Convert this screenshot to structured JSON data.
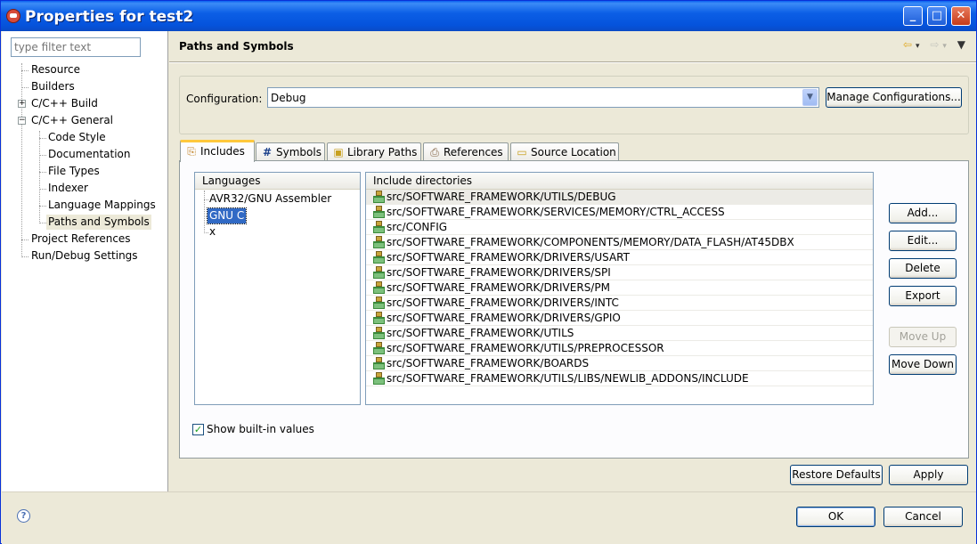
{
  "window": {
    "title": "Properties for test2"
  },
  "nav": {
    "filter_placeholder": "type filter text",
    "items": [
      {
        "label": "Resource"
      },
      {
        "label": "Builders"
      },
      {
        "label": "C/C++ Build"
      },
      {
        "label": "C/C++ General"
      },
      {
        "label": "Code Style"
      },
      {
        "label": "Documentation"
      },
      {
        "label": "File Types"
      },
      {
        "label": "Indexer"
      },
      {
        "label": "Language Mappings"
      },
      {
        "label": "Paths and Symbols"
      },
      {
        "label": "Project References"
      },
      {
        "label": "Run/Debug Settings"
      }
    ]
  },
  "page": {
    "title": "Paths and Symbols"
  },
  "config": {
    "label": "Configuration:",
    "value": "Debug",
    "manage_label": "Manage Configurations..."
  },
  "tabs": [
    {
      "label": "Includes",
      "icon": "includes-icon"
    },
    {
      "label": "Symbols",
      "icon": "hash-icon"
    },
    {
      "label": "Library Paths",
      "icon": "library-icon"
    },
    {
      "label": "References",
      "icon": "references-icon"
    },
    {
      "label": "Source Location",
      "icon": "folder-icon"
    }
  ],
  "languages": {
    "header": "Languages",
    "items": [
      "AVR32/GNU Assembler",
      "GNU C",
      "x"
    ],
    "selected": "GNU C"
  },
  "includes": {
    "header": "Include directories",
    "items": [
      "src/SOFTWARE_FRAMEWORK/UTILS/DEBUG",
      "src/SOFTWARE_FRAMEWORK/SERVICES/MEMORY/CTRL_ACCESS",
      "src/CONFIG",
      "src/SOFTWARE_FRAMEWORK/COMPONENTS/MEMORY/DATA_FLASH/AT45DBX",
      "src/SOFTWARE_FRAMEWORK/DRIVERS/USART",
      "src/SOFTWARE_FRAMEWORK/DRIVERS/SPI",
      "src/SOFTWARE_FRAMEWORK/DRIVERS/PM",
      "src/SOFTWARE_FRAMEWORK/DRIVERS/INTC",
      "src/SOFTWARE_FRAMEWORK/DRIVERS/GPIO",
      "src/SOFTWARE_FRAMEWORK/UTILS",
      "src/SOFTWARE_FRAMEWORK/UTILS/PREPROCESSOR",
      "src/SOFTWARE_FRAMEWORK/BOARDS",
      "src/SOFTWARE_FRAMEWORK/UTILS/LIBS/NEWLIB_ADDONS/INCLUDE"
    ]
  },
  "side_buttons": {
    "add": "Add...",
    "edit": "Edit...",
    "delete": "Delete",
    "export": "Export",
    "move_up": "Move Up",
    "move_down": "Move Down"
  },
  "show_builtin": {
    "label": "Show built-in values",
    "checked": true
  },
  "footer": {
    "restore_defaults": "Restore Defaults",
    "apply": "Apply",
    "ok": "OK",
    "cancel": "Cancel"
  }
}
